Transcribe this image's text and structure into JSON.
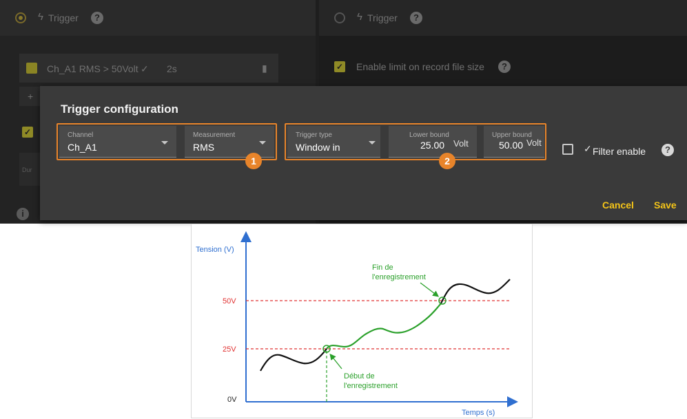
{
  "background_app": {
    "left": {
      "trigger_label": "Trigger",
      "rule_text": "Ch_A1 RMS > 50Volt",
      "rule_duration": "2s",
      "small_label": "Dur"
    },
    "right": {
      "trigger_label": "Trigger",
      "enable_limit_label": "Enable limit on record file size"
    }
  },
  "dialog": {
    "title": "Trigger configuration",
    "channel": {
      "label": "Channel",
      "value": "Ch_A1"
    },
    "measurement": {
      "label": "Measurement",
      "value": "RMS"
    },
    "trigger_type": {
      "label": "Trigger type",
      "value": "Window in"
    },
    "lower_bound": {
      "label": "Lower bound",
      "value": "25.00",
      "unit": "Volt"
    },
    "upper_bound": {
      "label": "Upper bound",
      "value": "50.00",
      "unit": "Volt"
    },
    "filter_enable_label": "Filter enable",
    "badge_1": "1",
    "badge_2": "2",
    "cancel_label": "Cancel",
    "save_label": "Save"
  },
  "diagram": {
    "y_axis_label": "Tension (V)",
    "x_axis_label": "Temps (s)",
    "level_50": "50V",
    "level_25": "25V",
    "level_0": "0V",
    "start_annotation_line1": "Début de",
    "start_annotation_line2": "l'enregistrement",
    "end_annotation_line1": "Fin de",
    "end_annotation_line2": "l'enregistrement",
    "colors": {
      "threshold": "#e03030",
      "recording": "#2aa02a",
      "signal": "#111111",
      "axis": "#2f6fd0"
    }
  }
}
